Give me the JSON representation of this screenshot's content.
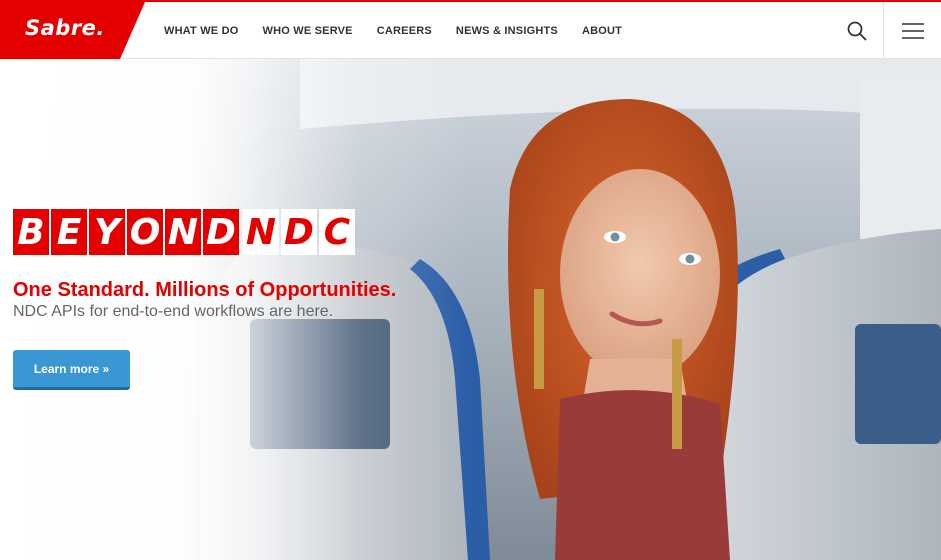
{
  "header": {
    "logo": "Sabre.",
    "nav": [
      {
        "label": "WHAT WE DO"
      },
      {
        "label": "WHO WE SERVE"
      },
      {
        "label": "CAREERS"
      },
      {
        "label": "NEWS & INSIGHTS"
      },
      {
        "label": "ABOUT"
      }
    ],
    "search_icon": "search-icon",
    "menu_icon": "hamburger-icon"
  },
  "hero": {
    "beyond_letters": [
      "B",
      "E",
      "Y",
      "O",
      "N",
      "D"
    ],
    "ndc_letters": [
      "N",
      "D",
      "C"
    ],
    "headline": "One Standard. Millions of Opportunities.",
    "subhead": "NDC APIs for end-to-end workflows are here.",
    "cta_label": "Learn more »"
  },
  "colors": {
    "brand_red": "#e50000",
    "cta_blue": "#3a97d4",
    "nav_text": "#333333"
  }
}
